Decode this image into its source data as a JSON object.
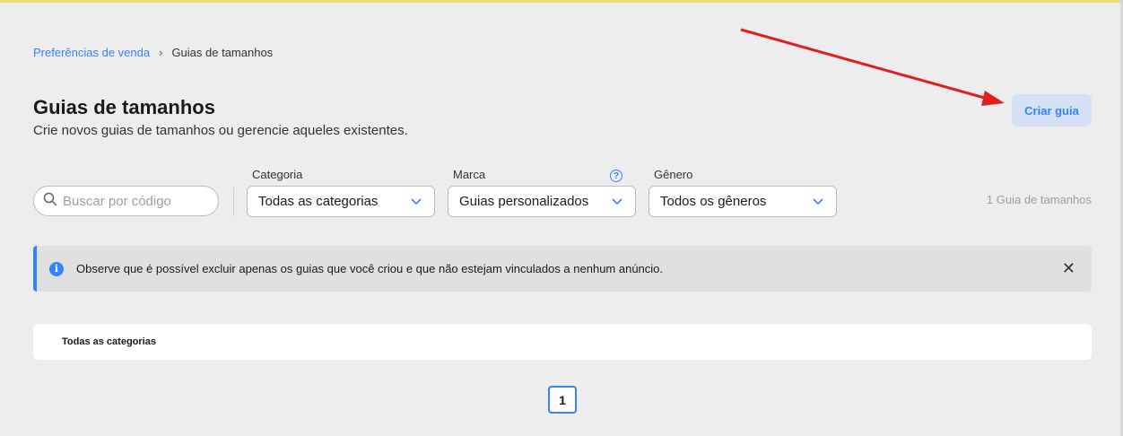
{
  "breadcrumb": {
    "parent": "Preferências de venda",
    "separator": "›",
    "current": "Guias de tamanhos"
  },
  "header": {
    "title": "Guias de tamanhos",
    "subtitle": "Crie novos guias de tamanhos ou gerencie aqueles existentes.",
    "create_button": "Criar guia"
  },
  "filters": {
    "search_placeholder": "Buscar por código",
    "category": {
      "label": "Categoria",
      "value": "Todas as categorias"
    },
    "brand": {
      "label": "Marca",
      "value": "Guias personalizados"
    },
    "gender": {
      "label": "Gênero",
      "value": "Todos os gêneros"
    },
    "count_text": "1 Guia de tamanhos"
  },
  "notice": {
    "text": "Observe que é possível excluir apenas os guias que você criou e que não estejam vinculados a nenhum anúncio.",
    "icon": "info-icon",
    "close": "✕"
  },
  "list": {
    "category_row": "Todas as categorias"
  },
  "pagination": {
    "current_page": "1"
  },
  "colors": {
    "accent": "#3483fa",
    "background": "#ededed",
    "annotation": "#e02020"
  }
}
